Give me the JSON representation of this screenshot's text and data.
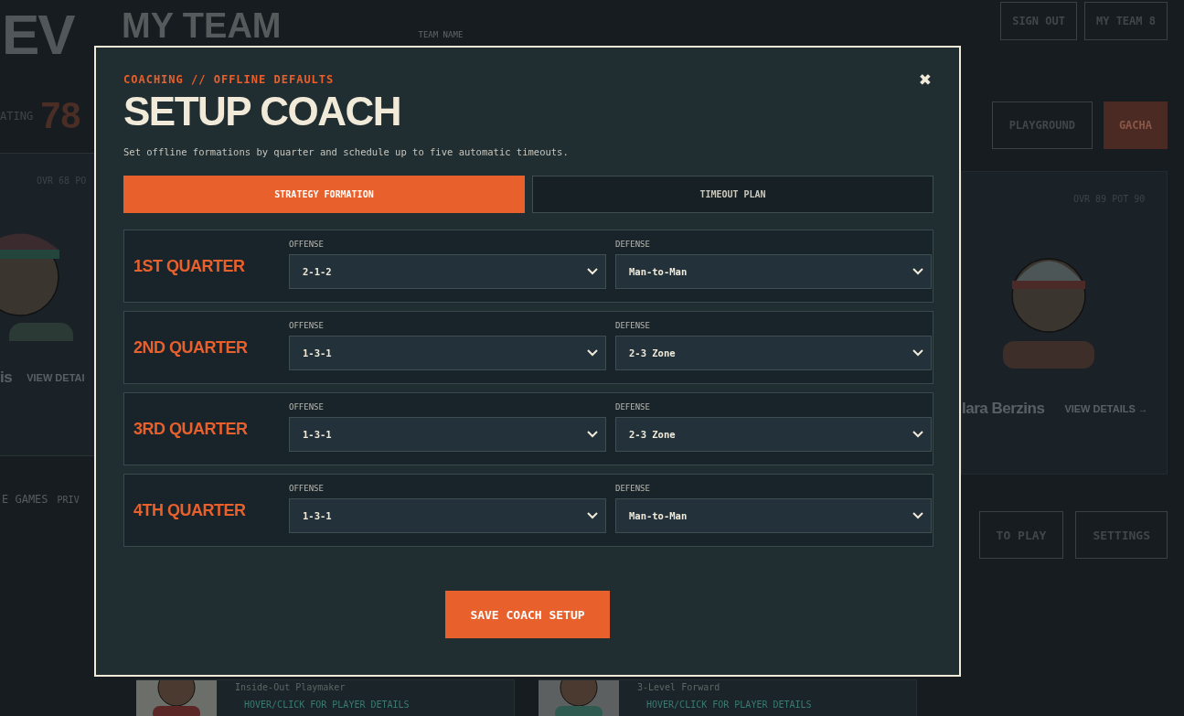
{
  "background": {
    "logo": "EV",
    "page_title": "MY TEAM",
    "team_name_label": "TEAM NAME",
    "rating_label": "ATING",
    "rating": "78",
    "left_card": {
      "stats": "OVR 68  PO",
      "name": "is",
      "link": "VIEW DETAI"
    },
    "left_links": [
      "E GAMES",
      "PRIV"
    ],
    "top_buttons": [
      "SIGN OUT",
      "MY TEAM 8"
    ],
    "nav_buttons": [
      {
        "label": "PLAYGROUND",
        "kind": "outline"
      },
      {
        "label": "GACHA",
        "kind": "accent"
      }
    ],
    "right_card": {
      "stats": "OVR 89  POT 90",
      "name": "lara Berzins",
      "link": "VIEW DETAILS →"
    },
    "bottom_buttons": [
      "TO PLAY",
      "SETTINGS"
    ],
    "cards": [
      {
        "role": "Inside-Out Playmaker",
        "hint": "HOVER/CLICK FOR PLAYER DETAILS"
      },
      {
        "role": "3-Level Forward",
        "hint": "HOVER/CLICK FOR PLAYER DETAILS"
      }
    ]
  },
  "modal": {
    "eyebrow": "COACHING // OFFLINE DEFAULTS",
    "title": "SETUP COACH",
    "close": "✖",
    "subtitle": "Set offline formations by quarter and schedule up to five automatic timeouts.",
    "tabs": [
      {
        "label": "STRATEGY FORMATION",
        "selected": true
      },
      {
        "label": "TIMEOUT PLAN",
        "selected": false
      }
    ],
    "quarters": [
      {
        "name": "1ST QUARTER",
        "offense_label": "OFFENSE",
        "offense": "2-1-2",
        "defense_label": "DEFENSE",
        "defense": "Man-to-Man"
      },
      {
        "name": "2ND QUARTER",
        "offense_label": "OFFENSE",
        "offense": "1-3-1",
        "defense_label": "DEFENSE",
        "defense": "2-3 Zone"
      },
      {
        "name": "3RD QUARTER",
        "offense_label": "OFFENSE",
        "offense": "1-3-1",
        "defense_label": "DEFENSE",
        "defense": "2-3 Zone"
      },
      {
        "name": "4TH QUARTER",
        "offense_label": "OFFENSE",
        "offense": "1-3-1",
        "defense_label": "DEFENSE",
        "defense": "Man-to-Man"
      }
    ],
    "save_button": "SAVE COACH SETUP"
  }
}
